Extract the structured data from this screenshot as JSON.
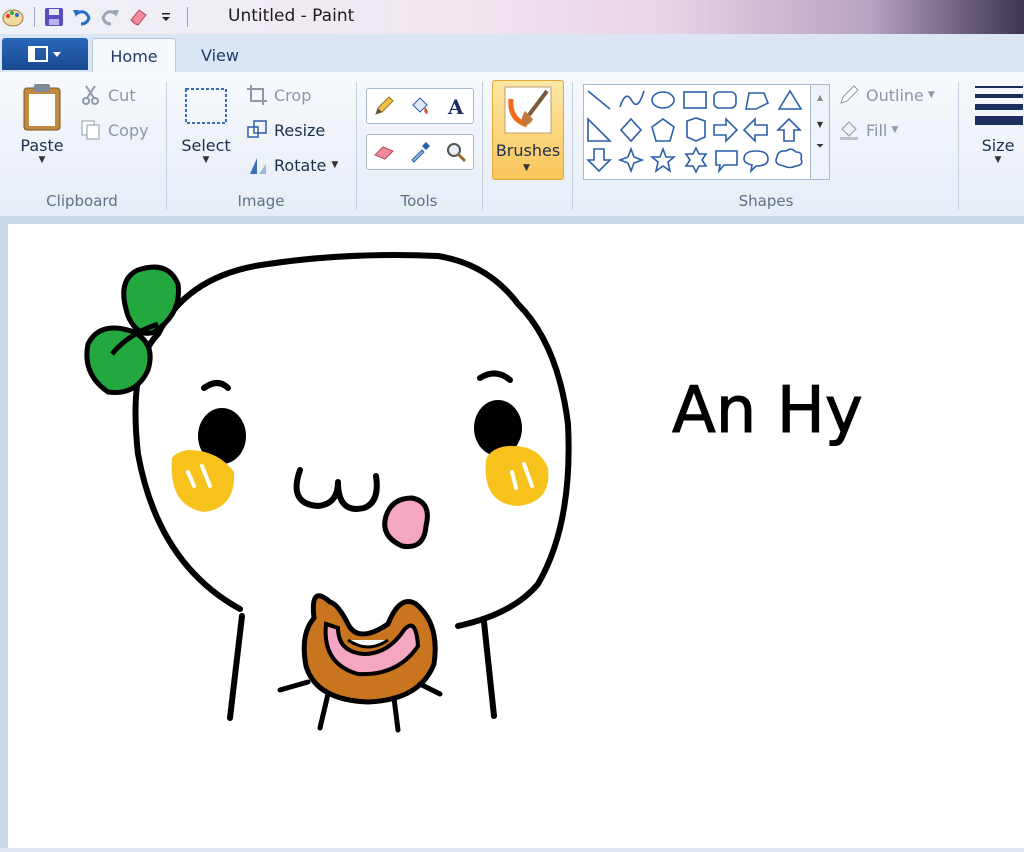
{
  "window": {
    "title": "Untitled - Paint"
  },
  "quick_access": [
    {
      "name": "paint-app-icon"
    },
    {
      "name": "save-icon"
    },
    {
      "name": "undo-icon"
    },
    {
      "name": "redo-icon"
    },
    {
      "name": "eraser-quick-icon"
    },
    {
      "name": "customize-dropdown-icon"
    }
  ],
  "tabs": {
    "home": "Home",
    "view": "View"
  },
  "clipboard": {
    "paste": "Paste",
    "cut": "Cut",
    "copy": "Copy",
    "label": "Clipboard"
  },
  "image": {
    "select": "Select",
    "crop": "Crop",
    "resize": "Resize",
    "rotate": "Rotate",
    "label": "Image"
  },
  "tools": {
    "label": "Tools"
  },
  "brushes": {
    "label": "Brushes"
  },
  "shapes": {
    "outline": "Outline",
    "fill": "Fill",
    "label": "Shapes"
  },
  "size": {
    "label": "Size"
  },
  "drawing": {
    "text": "An Hy"
  },
  "colors": {
    "ribbon_blue": "#1a4a92",
    "brushes_active": "#f9c65a",
    "leaf_green": "#22a83f",
    "cheek_yellow": "#f6c21b",
    "tongue_pink": "#f4a6c2",
    "donut_brown": "#c9741f"
  }
}
